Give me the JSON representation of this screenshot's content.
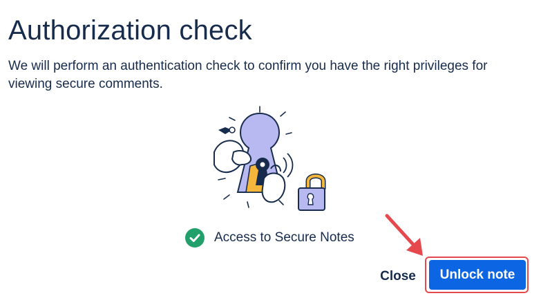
{
  "dialog": {
    "title": "Authorization check",
    "description": "We will perform an authentication check to confirm you have the right privileges for viewing secure comments."
  },
  "illustration": {
    "icon": "keyhole-lock-illustration"
  },
  "access": {
    "label": "Access to Secure Notes",
    "icon": "check-circle-icon",
    "status_color": "#22a06b"
  },
  "actions": {
    "close_label": "Close",
    "unlock_label": "Unlock note",
    "primary_color": "#0c66e4"
  },
  "annotation": {
    "color": "#e5484d",
    "icon": "arrow-annotation"
  }
}
